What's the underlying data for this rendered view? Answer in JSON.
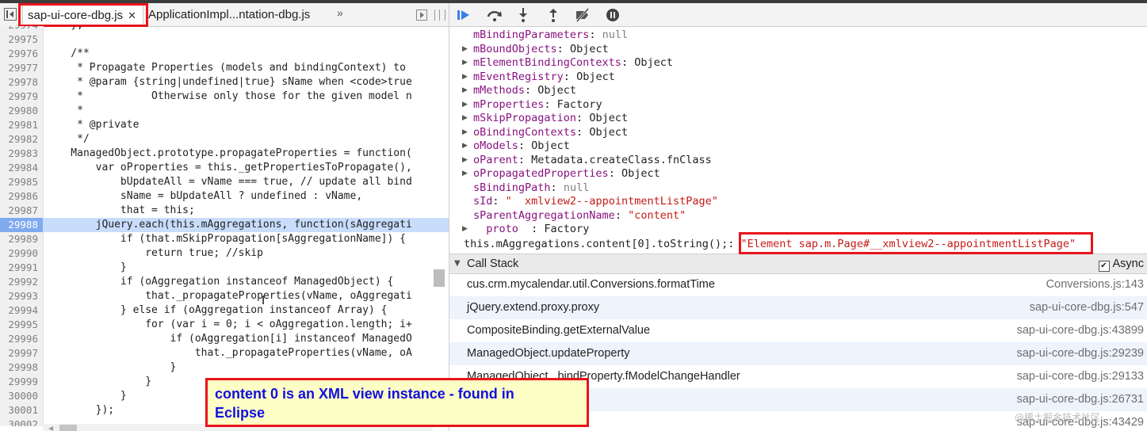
{
  "tabs": {
    "active": "sap-ui-core-dbg.js",
    "close": "✕",
    "second": "ApplicationImpl...ntation-dbg.js",
    "more": "»"
  },
  "code_lines": [
    {
      "n": "29974",
      "t": "    };",
      "hl": false
    },
    {
      "n": "29975",
      "t": "",
      "hl": false
    },
    {
      "n": "29976",
      "t": "    /**",
      "hl": false
    },
    {
      "n": "29977",
      "t": "     * Propagate Properties (models and bindingContext) to",
      "hl": false
    },
    {
      "n": "29978",
      "t": "     * @param {string|undefined|true} sName when <code>true",
      "hl": false
    },
    {
      "n": "29979",
      "t": "     *           Otherwise only those for the given model n",
      "hl": false
    },
    {
      "n": "29980",
      "t": "     *",
      "hl": false
    },
    {
      "n": "29981",
      "t": "     * @private",
      "hl": false
    },
    {
      "n": "29982",
      "t": "     */",
      "hl": false
    },
    {
      "n": "29983",
      "t": "    ManagedObject.prototype.propagateProperties = function(",
      "hl": false
    },
    {
      "n": "29984",
      "t": "        var oProperties = this._getPropertiesToPropagate(),",
      "hl": false
    },
    {
      "n": "29985",
      "t": "            bUpdateAll = vName === true, // update all bind",
      "hl": false
    },
    {
      "n": "29986",
      "t": "            sName = bUpdateAll ? undefined : vName,",
      "hl": false
    },
    {
      "n": "29987",
      "t": "            that = this;",
      "hl": false
    },
    {
      "n": "29988",
      "t": "        jQuery.each(this.mAggregations, function(sAggregati",
      "hl": true
    },
    {
      "n": "29989",
      "t": "            if (that.mSkipPropagation[sAggregationName]) {",
      "hl": false
    },
    {
      "n": "29990",
      "t": "                return true; //skip",
      "hl": false
    },
    {
      "n": "29991",
      "t": "            }",
      "hl": false
    },
    {
      "n": "29992",
      "t": "            if (oAggregation instanceof ManagedObject) {",
      "hl": false
    },
    {
      "n": "29993",
      "t": "                that._propagateProperties(vName, oAggregati",
      "hl": false
    },
    {
      "n": "29994",
      "t": "            } else if (oAggregation instanceof Array) {",
      "hl": false
    },
    {
      "n": "29995",
      "t": "                for (var i = 0; i < oAggregation.length; i+",
      "hl": false
    },
    {
      "n": "29996",
      "t": "                    if (oAggregation[i] instanceof ManagedO",
      "hl": false
    },
    {
      "n": "29997",
      "t": "                        that._propagateProperties(vName, oA",
      "hl": false
    },
    {
      "n": "29998",
      "t": "                    }",
      "hl": false
    },
    {
      "n": "29999",
      "t": "                }",
      "hl": false
    },
    {
      "n": "30000",
      "t": "            }",
      "hl": false
    },
    {
      "n": "30001",
      "t": "        });",
      "hl": false
    },
    {
      "n": "30002",
      "t": "",
      "hl": false
    }
  ],
  "scope_props": [
    {
      "key": "mBindingParameters",
      "value": "null",
      "type": "null",
      "expandable": false
    },
    {
      "key": "mBoundObjects",
      "value": "Object",
      "type": "obj",
      "expandable": true
    },
    {
      "key": "mElementBindingContexts",
      "value": "Object",
      "type": "obj",
      "expandable": true
    },
    {
      "key": "mEventRegistry",
      "value": "Object",
      "type": "obj",
      "expandable": true
    },
    {
      "key": "mMethods",
      "value": "Object",
      "type": "obj",
      "expandable": true
    },
    {
      "key": "mProperties",
      "value": "Factory",
      "type": "obj",
      "expandable": true
    },
    {
      "key": "mSkipPropagation",
      "value": "Object",
      "type": "obj",
      "expandable": true
    },
    {
      "key": "oBindingContexts",
      "value": "Object",
      "type": "obj",
      "expandable": true
    },
    {
      "key": "oModels",
      "value": "Object",
      "type": "obj",
      "expandable": true
    },
    {
      "key": "oParent",
      "value": "Metadata.createClass.fnClass",
      "type": "obj",
      "expandable": true
    },
    {
      "key": "oPropagatedProperties",
      "value": "Object",
      "type": "obj",
      "expandable": true
    },
    {
      "key": "sBindingPath",
      "value": "null",
      "type": "null",
      "expandable": false
    },
    {
      "key": "sId",
      "value": "\"  xmlview2--appointmentListPage\"",
      "type": "str",
      "expandable": false
    },
    {
      "key": "sParentAggregationName",
      "value": "\"content\"",
      "type": "str",
      "expandable": false
    },
    {
      "key": "  proto  ",
      "value": "Factory",
      "type": "obj",
      "expandable": true
    }
  ],
  "watch": {
    "expression": "this.mAggregations.content[0].toString();:",
    "result": "\"Element sap.m.Page#__xmlview2--appointmentListPage\""
  },
  "call_stack": {
    "title": "Call Stack",
    "async_label": "Async",
    "async_checked": true,
    "frames": [
      {
        "fn": "cus.crm.mycalendar.util.Conversions.formatTime",
        "loc": "Conversions.js:143"
      },
      {
        "fn": "jQuery.extend.proxy.proxy",
        "loc": "sap-ui-core-dbg.js:547"
      },
      {
        "fn": "CompositeBinding.getExternalValue",
        "loc": "sap-ui-core-dbg.js:43899"
      },
      {
        "fn": "ManagedObject.updateProperty",
        "loc": "sap-ui-core-dbg.js:29239"
      },
      {
        "fn": "ManagedObject._bindProperty.fModelChangeHandler",
        "loc": "sap-ui-core-dbg.js:29133"
      },
      {
        "fn": "",
        "loc": "sap-ui-core-dbg.js:26731"
      },
      {
        "fn": "",
        "loc": "sap-ui-core-dbg.js:43429"
      }
    ]
  },
  "annotation": {
    "line1": "content 0 is an XML view instance - found in",
    "line2": "Eclipse"
  },
  "watermark": "@稀土掘金技术社区",
  "colors": {
    "highlight": "#c8dcfb",
    "red_box": "#e8141c",
    "annotation_text": "#1010e0",
    "annotation_bg": "#fdfdc6"
  },
  "icons": [
    "resume-icon",
    "step-over-icon",
    "step-into-icon",
    "step-out-icon",
    "deactivate-breakpoints-icon",
    "pause-on-exceptions-icon"
  ]
}
